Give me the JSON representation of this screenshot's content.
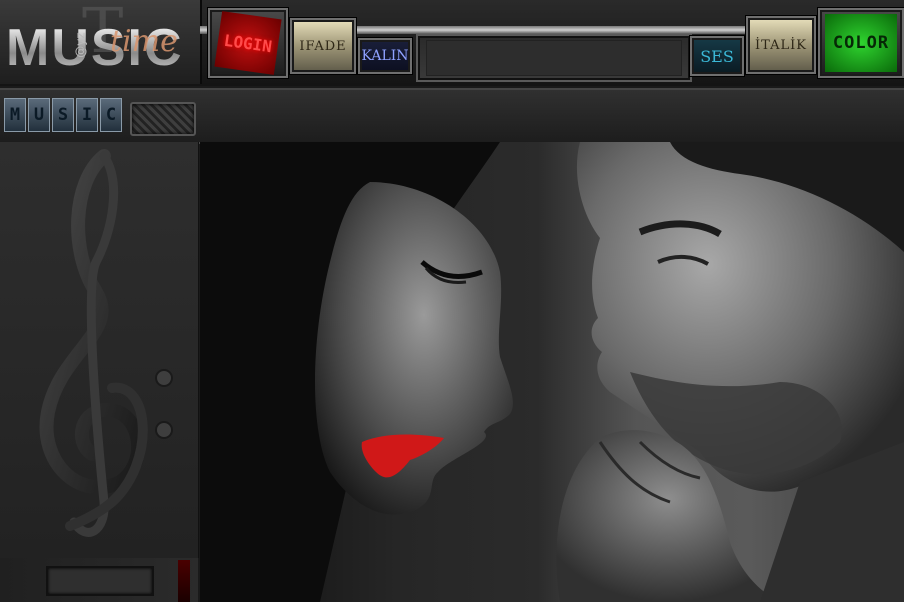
{
  "logo": {
    "word": "MUSIC",
    "script": "time",
    "small": "@yz"
  },
  "toolbar": {
    "login": "LOGIN",
    "ifade": "IFADE",
    "kalin": "KALIN",
    "ses": "SES",
    "italik": "İTALİK",
    "color": "COLOR",
    "message_input": {
      "value": "",
      "placeholder": ""
    }
  },
  "subbar": {
    "tabs": [
      "M",
      "U",
      "S",
      "I",
      "C"
    ]
  },
  "icons": {
    "left_panel": "treble-bass-clef-icon"
  },
  "colors": {
    "login": "#c21010",
    "color_button": "#2fd42f",
    "ses": "#3bb8d6",
    "kalin": "#8fa2ff",
    "lips": "#d01818"
  }
}
